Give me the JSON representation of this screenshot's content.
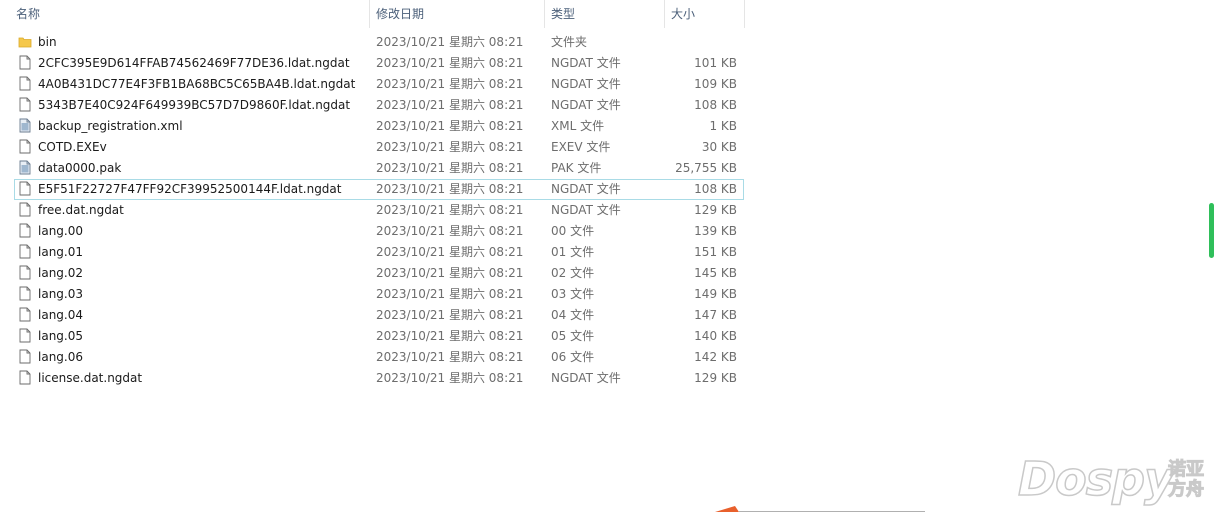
{
  "columns": {
    "name": "名称",
    "date": "修改日期",
    "type": "类型",
    "size": "大小"
  },
  "files": [
    {
      "name": "bin",
      "date": "2023/10/21 星期六 08:21",
      "type": "文件夹",
      "size": "",
      "icon": "folder-icon"
    },
    {
      "name": "2CFC395E9D614FFAB74562469F77DE36.ldat.ngdat",
      "date": "2023/10/21 星期六 08:21",
      "type": "NGDAT 文件",
      "size": "101 KB",
      "icon": "file-icon"
    },
    {
      "name": "4A0B431DC77E4F3FB1BA68BC5C65BA4B.ldat.ngdat",
      "date": "2023/10/21 星期六 08:21",
      "type": "NGDAT 文件",
      "size": "109 KB",
      "icon": "file-icon"
    },
    {
      "name": "5343B7E40C924F649939BC57D7D9860F.ldat.ngdat",
      "date": "2023/10/21 星期六 08:21",
      "type": "NGDAT 文件",
      "size": "108 KB",
      "icon": "file-icon"
    },
    {
      "name": "backup_registration.xml",
      "date": "2023/10/21 星期六 08:21",
      "type": "XML 文件",
      "size": "1 KB",
      "icon": "data-file-icon"
    },
    {
      "name": "COTD.EXEv",
      "date": "2023/10/21 星期六 08:21",
      "type": "EXEV 文件",
      "size": "30 KB",
      "icon": "file-icon"
    },
    {
      "name": "data0000.pak",
      "date": "2023/10/21 星期六 08:21",
      "type": "PAK 文件",
      "size": "25,755 KB",
      "icon": "data-file-icon"
    },
    {
      "name": "E5F51F22727F47FF92CF39952500144F.ldat.ngdat",
      "date": "2023/10/21 星期六 08:21",
      "type": "NGDAT 文件",
      "size": "108 KB",
      "icon": "file-icon",
      "selected": true
    },
    {
      "name": "free.dat.ngdat",
      "date": "2023/10/21 星期六 08:21",
      "type": "NGDAT 文件",
      "size": "129 KB",
      "icon": "file-icon"
    },
    {
      "name": "lang.00",
      "date": "2023/10/21 星期六 08:21",
      "type": "00 文件",
      "size": "139 KB",
      "icon": "file-icon"
    },
    {
      "name": "lang.01",
      "date": "2023/10/21 星期六 08:21",
      "type": "01 文件",
      "size": "151 KB",
      "icon": "file-icon"
    },
    {
      "name": "lang.02",
      "date": "2023/10/21 星期六 08:21",
      "type": "02 文件",
      "size": "145 KB",
      "icon": "file-icon"
    },
    {
      "name": "lang.03",
      "date": "2023/10/21 星期六 08:21",
      "type": "03 文件",
      "size": "149 KB",
      "icon": "file-icon"
    },
    {
      "name": "lang.04",
      "date": "2023/10/21 星期六 08:21",
      "type": "04 文件",
      "size": "147 KB",
      "icon": "file-icon"
    },
    {
      "name": "lang.05",
      "date": "2023/10/21 星期六 08:21",
      "type": "05 文件",
      "size": "140 KB",
      "icon": "file-icon"
    },
    {
      "name": "lang.06",
      "date": "2023/10/21 星期六 08:21",
      "type": "06 文件",
      "size": "142 KB",
      "icon": "file-icon"
    },
    {
      "name": "license.dat.ngdat",
      "date": "2023/10/21 星期六 08:21",
      "type": "NGDAT 文件",
      "size": "129 KB",
      "icon": "file-icon"
    }
  ],
  "watermark": {
    "logo": "Dospy",
    "cn": "诺亚方舟"
  },
  "colors": {
    "selection_border": "#a9dbe6",
    "folder": "#f5c84c",
    "scroll_thumb": "#2fbf5a",
    "accent_orange": "#e8602c"
  }
}
